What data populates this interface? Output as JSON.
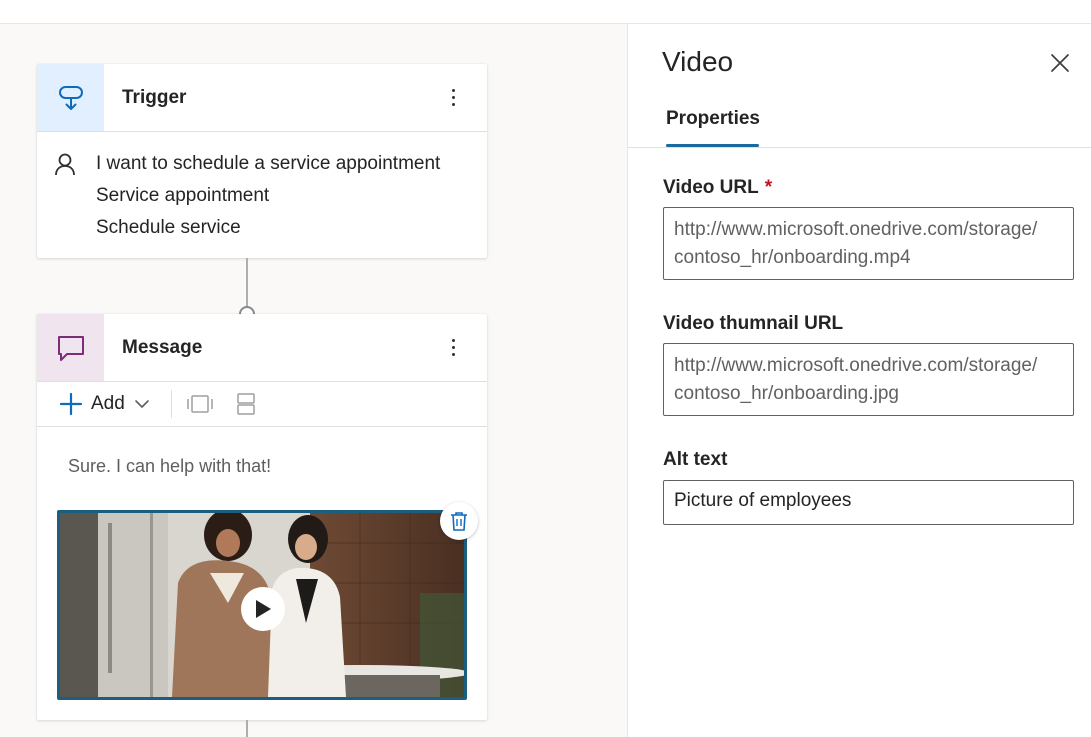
{
  "canvas": {
    "trigger": {
      "title": "Trigger",
      "phrases": [
        "I want to schedule a service appointment",
        "Service appointment",
        "Schedule service"
      ]
    },
    "message": {
      "title": "Message",
      "add_label": "Add",
      "text": "Sure. I can help with that!"
    }
  },
  "panel": {
    "title": "Video",
    "tab": "Properties",
    "video_url": {
      "label": "Video URL",
      "required_mark": "*",
      "value_line1": "http://www.microsoft.onedrive.com/storage/",
      "value_line2": "contoso_hr/onboarding.mp4"
    },
    "thumbnail_url": {
      "label": "Video thumnail URL",
      "value_line1": "http://www.microsoft.onedrive.com/storage/",
      "value_line2": "contoso_hr/onboarding.jpg"
    },
    "alt_text": {
      "label": "Alt text",
      "value": "Picture of employees"
    }
  },
  "colors": {
    "accent": "#1b6a9e",
    "trigger_icon_bg": "#e1efff",
    "message_icon_bg": "#f0e4ef",
    "required": "#c50f1f"
  }
}
